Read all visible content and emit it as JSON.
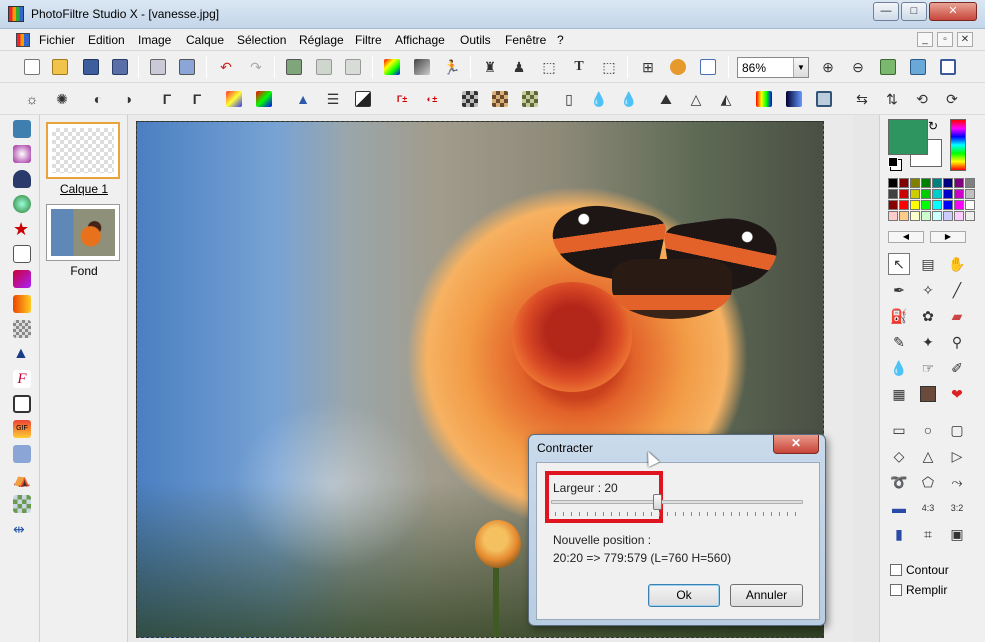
{
  "window": {
    "title": "PhotoFiltre Studio X - [vanesse.jpg]",
    "minimize_glyph": "—",
    "maximize_glyph": "□",
    "close_glyph": "✕"
  },
  "menu": {
    "items": [
      "Fichier",
      "Edition",
      "Image",
      "Calque",
      "Sélection",
      "Réglage",
      "Filtre",
      "Affichage",
      "Outils",
      "Fenêtre",
      "?"
    ]
  },
  "toolbar": {
    "zoom_value": "86%"
  },
  "layers": {
    "items": [
      {
        "label": "Calque 1",
        "selected": true
      },
      {
        "label": "Fond",
        "selected": false
      }
    ]
  },
  "dialog": {
    "title": "Contracter",
    "close_glyph": "✕",
    "width_label": "Largeur : 20",
    "slider_value": 20,
    "slider_max": 48,
    "position_heading": "Nouvelle position :",
    "position_value": "20:20 => 779:579 (L=760  H=560)",
    "ok_label": "Ok",
    "cancel_label": "Annuler",
    "highlight_color": "#e0141e"
  },
  "colors": {
    "foreground": "#2e9460",
    "background": "#ffffff"
  },
  "options": {
    "contour_label": "Contour",
    "fill_label": "Remplir"
  }
}
